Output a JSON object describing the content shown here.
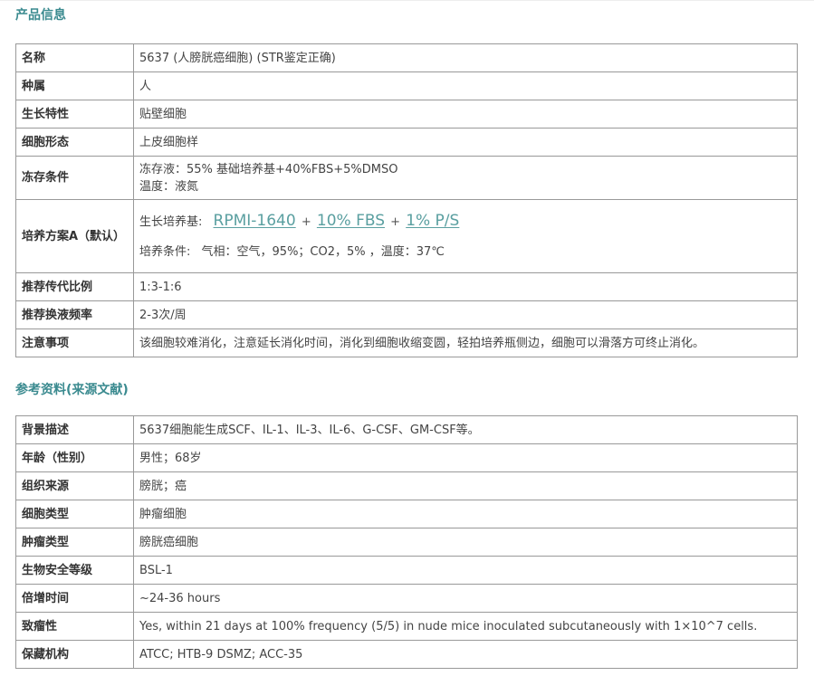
{
  "sections": {
    "product_info": "产品信息",
    "references": "参考资料(来源文献)"
  },
  "product": {
    "name": {
      "key": "名称",
      "value": "5637 (人膀胱癌细胞) (STR鉴定正确)"
    },
    "species": {
      "key": "种属",
      "value": "人"
    },
    "growth": {
      "key": "生长特性",
      "value": "贴壁细胞"
    },
    "morphology": {
      "key": "细胞形态",
      "value": "上皮细胞样"
    },
    "freeze": {
      "key": "冻存条件",
      "line1": "冻存液：55% 基础培养基+40%FBS+5%DMSO",
      "line2": "温度：液氮"
    },
    "culture": {
      "key": "培养方案A（默认）",
      "medium_label": "生长培养基:",
      "medium_items": [
        "RPMI-1640",
        "10% FBS",
        "1% P/S"
      ],
      "plus": "+",
      "conditions_label": "培养条件:",
      "conditions": "气相：空气，95%；CO2，5%  ，温度：37℃"
    },
    "split": {
      "key": "推荐传代比例",
      "value": "1:3-1:6"
    },
    "medium_change": {
      "key": "推荐换液频率",
      "value": "2-3次/周"
    },
    "notes": {
      "key": "注意事项",
      "value": "该细胞较难消化，注意延长消化时间，消化到细胞收缩变圆，轻拍培养瓶侧边，细胞可以滑落方可终止消化。"
    }
  },
  "reference": {
    "background": {
      "key": "背景描述",
      "value": "5637细胞能生成SCF、IL-1、IL-3、IL-6、G-CSF、GM-CSF等。"
    },
    "age": {
      "key": "年龄（性别）",
      "value": "男性；68岁"
    },
    "tissue": {
      "key": "组织来源",
      "value": "膀胱；癌"
    },
    "cell_type": {
      "key": "细胞类型",
      "value": "肿瘤细胞"
    },
    "tumor_type": {
      "key": "肿瘤类型",
      "value": "膀胱癌细胞"
    },
    "biosafety": {
      "key": "生物安全等级",
      "value": "BSL-1"
    },
    "doubling": {
      "key": "倍增时间",
      "value": "~24-36 hours"
    },
    "tumorigenicity": {
      "key": "致瘤性",
      "value": "Yes, within 21 days at 100% frequency (5/5) in nude mice inoculated subcutaneously with 1×10^7 cells."
    },
    "repository": {
      "key": "保藏机构",
      "value": "ATCC; HTB-9 DSMZ; ACC-35"
    }
  }
}
